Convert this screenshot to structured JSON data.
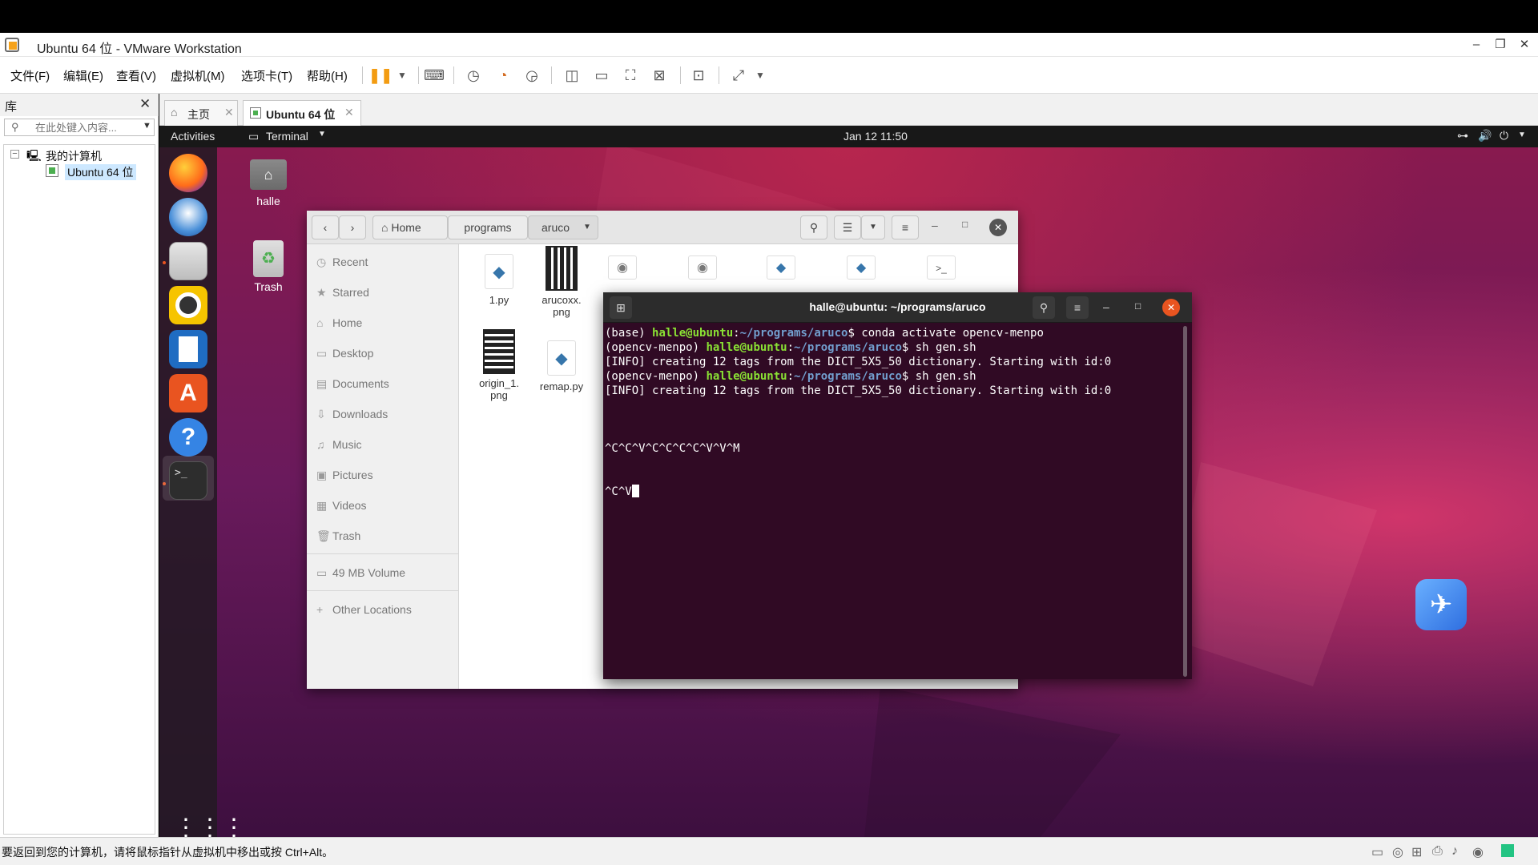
{
  "window": {
    "title": "Ubuntu 64 位 - VMware Workstation"
  },
  "menubar": {
    "items": [
      "文件(F)",
      "编辑(E)",
      "查看(V)",
      "虚拟机(M)",
      "选项卡(T)",
      "帮助(H)"
    ]
  },
  "library": {
    "title": "库",
    "search_placeholder": "在此处键入内容...",
    "tree": {
      "root": "我的计算机",
      "child": "Ubuntu 64 位"
    }
  },
  "tabs": [
    {
      "label": "主页"
    },
    {
      "label": "Ubuntu 64 位"
    }
  ],
  "guest": {
    "topbar": {
      "activities": "Activities",
      "app": "Terminal",
      "clock": "Jan 12  11:50"
    },
    "desktop_icons": [
      {
        "label": "halle"
      },
      {
        "label": "Trash"
      }
    ]
  },
  "files": {
    "path": [
      "Home",
      "programs",
      "aruco"
    ],
    "sidebar": [
      "Recent",
      "Starred",
      "Home",
      "Desktop",
      "Documents",
      "Downloads",
      "Music",
      "Pictures",
      "Videos",
      "Trash",
      "49 MB Volume",
      "Other Locations"
    ],
    "items": [
      {
        "name": "1.py",
        "name2": ""
      },
      {
        "name": "arucoxx.",
        "name2": "png"
      },
      {
        "name": "origin_1.",
        "name2": "png"
      },
      {
        "name": "remap.py",
        "name2": ""
      }
    ]
  },
  "terminal": {
    "title": "halle@ubuntu: ~/programs/aruco",
    "lines": [
      {
        "env": "(base) ",
        "user": "halle@ubuntu",
        "sep": ":",
        "path": "~/programs/aruco",
        "cmd": "$ conda activate opencv-menpo"
      },
      {
        "env": "(opencv-menpo) ",
        "user": "halle@ubuntu",
        "sep": ":",
        "path": "~/programs/aruco",
        "cmd": "$ sh gen.sh"
      },
      {
        "text": "[INFO] creating 12 tags from the DICT_5X5_50 dictionary. Starting with id:0"
      },
      {
        "env": "(opencv-menpo) ",
        "user": "halle@ubuntu",
        "sep": ":",
        "path": "~/programs/aruco",
        "cmd": "$ sh gen.sh"
      },
      {
        "text": "[INFO] creating 12 tags from the DICT_5X5_50 dictionary. Starting with id:0"
      },
      {
        "text": "^C^C^V^C^C^C^C^V^V^M"
      },
      {
        "text": "^C^V"
      }
    ]
  },
  "statusbar": {
    "message": "要返回到您的计算机，请将鼠标指针从虚拟机中移出或按 Ctrl+Alt。"
  },
  "colors": {
    "terminal_bg": "#300a24",
    "prompt_user": "#8ae234",
    "prompt_path": "#729fcf",
    "close_button": "#e95420"
  }
}
